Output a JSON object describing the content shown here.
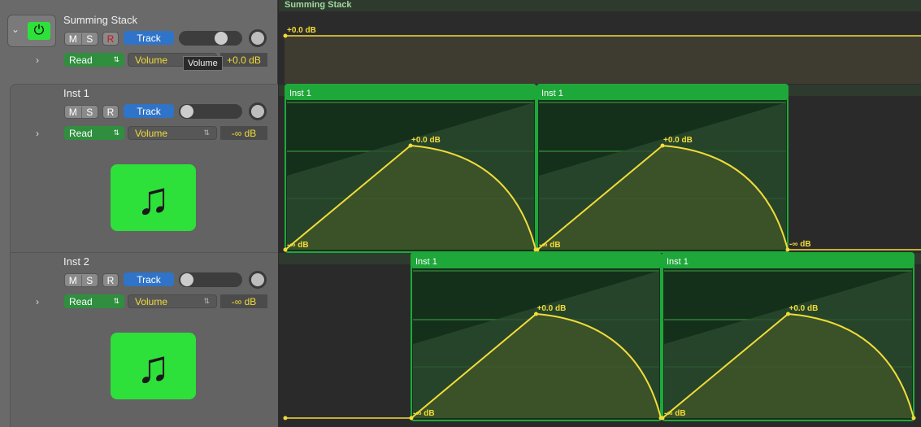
{
  "tooltip": "Volume",
  "tracks": [
    {
      "name": "Summing Stack",
      "mute": "M",
      "solo": "S",
      "record": "R",
      "track_button": "Track",
      "automation_mode": "Read",
      "parameter": "Volume",
      "value": "+0.0 dB",
      "record_armed": true
    },
    {
      "name": "Inst 1",
      "mute": "M",
      "solo": "S",
      "record": "R",
      "track_button": "Track",
      "automation_mode": "Read",
      "parameter": "Volume",
      "value": "-∞ dB"
    },
    {
      "name": "Inst 2",
      "mute": "M",
      "solo": "S",
      "record": "R",
      "track_button": "Track",
      "automation_mode": "Read",
      "parameter": "Volume",
      "value": "-∞ dB"
    }
  ],
  "arrange": {
    "stack_region": "Summing Stack",
    "stack_level": "+0.0 dB",
    "regions": [
      {
        "name": "Inst 1",
        "peak": "+0.0 dB",
        "floor": "-∞ dB"
      },
      {
        "name": "Inst 1",
        "peak": "+0.0 dB",
        "floor": "-∞ dB"
      },
      {
        "name": "Inst 1",
        "peak": "+0.0 dB",
        "floor": "-∞ dB"
      },
      {
        "name": "Inst 1",
        "peak": "+0.0 dB",
        "floor": "-∞ dB"
      }
    ],
    "tail_label": "-∞ dB"
  },
  "colors": {
    "region": "#1fa83a",
    "automation": "#f1dc3a",
    "icon": "#2ee03a"
  }
}
